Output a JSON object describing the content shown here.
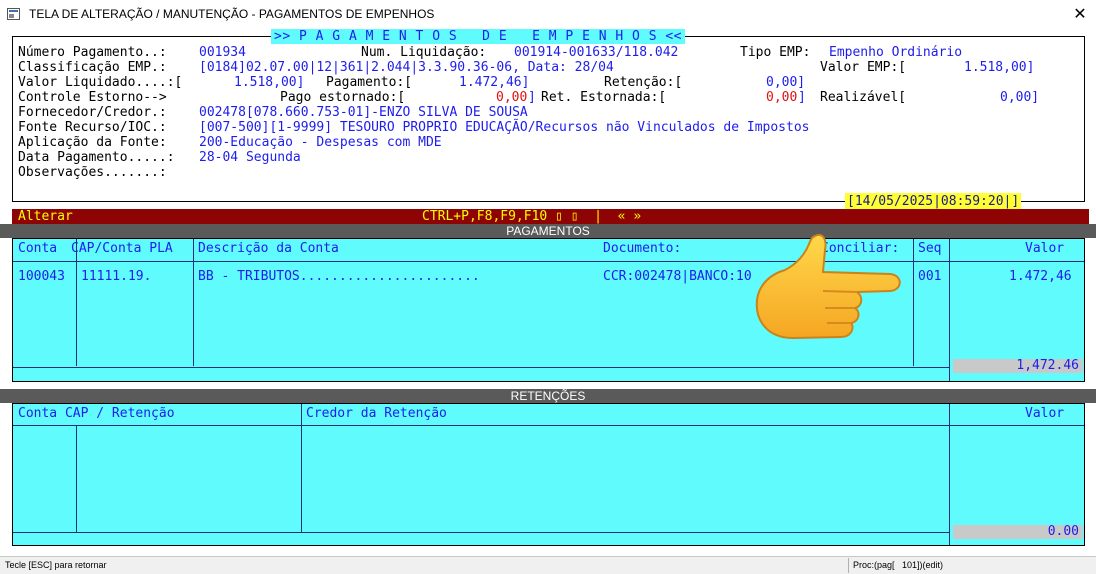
{
  "window": {
    "title": "TELA DE ALTERAÇÃO / MANUTENÇÃO - PAGAMENTOS DE EMPENHOS",
    "close_glyph": "✕"
  },
  "header": {
    "box_title": ">> P A G A M E N T O S   D E   E M P E N H O S <<",
    "numero_pagamento_label": "Número Pagamento..:",
    "numero_pagamento_value": "001934",
    "num_liquidacao_label": "Num. Liquidação:",
    "num_liquidacao_value": "001914-001633/118.042",
    "tipo_emp_label": "Tipo EMP:",
    "tipo_emp_value": "Empenho Ordinário",
    "classificacao_label": "Classificação EMP.:",
    "classificacao_value": "[0184]02.07.00|12|361|2.044|3.3.90.36-06, Data: 28/04",
    "valor_emp_label": "Valor EMP:[",
    "valor_emp_value": "1.518,00]",
    "valor_liquidado_label": "Valor Liquidado....:[",
    "valor_liquidado_value": "1.518,00]",
    "pagamento_label": "Pagamento:[",
    "pagamento_value": "1.472,46]",
    "retencao_label": "Retenção:[",
    "retencao_value": "0,00]",
    "controle_estorno_label": "Controle Estorno-->",
    "pago_estornado_label": "Pago estornado:[",
    "pago_estornado_value": "0,00",
    "ret_estornada_label": "Ret. Estornada:[",
    "ret_estornada_value": "0,00",
    "realizavel_label": "Realizável[",
    "realizavel_value": "0,00]",
    "bracket_close": "]",
    "fornecedor_label": "Fornecedor/Credor.:",
    "fornecedor_value": "002478[078.660.753-01]-ENZO SILVA DE SOUSA",
    "fonte_label": "Fonte Recurso/IOC.:",
    "fonte_value": "[007-500][1-9999] TESOURO PROPRIO EDUCAÇÃO/Recursos não Vinculados de Impostos",
    "aplicacao_label": "Aplicação da Fonte:",
    "aplicacao_value": "200-Educação - Despesas com MDE",
    "data_pagamento_label": "Data Pagamento.....:",
    "data_pagamento_value": "28-04 Segunda",
    "observacoes_label": "Observações.......:",
    "datetime": "[14/05/2025|08:59:20|]"
  },
  "actionbar": {
    "mode": "Alterar",
    "shortcuts": "CTRL+P,F8,F9,F10 ▯ ▯  |  « »"
  },
  "pagamentos": {
    "section_title": "PAGAMENTOS",
    "columns": [
      "Conta",
      "CAP/Conta PLA",
      "Descrição da Conta",
      "Documento:",
      "Conciliar:",
      "Seq",
      "Valor"
    ],
    "rows": [
      {
        "conta": "100043",
        "cap": "11111.19.",
        "descricao": "BB - TRIBUTOS.......................",
        "documento": "CCR:002478|BANCO:10",
        "conciliar": "",
        "seq": "001",
        "valor": "1.472,46"
      }
    ],
    "total": "1,472.46"
  },
  "retencoes": {
    "section_title": "RETENÇÕES",
    "columns": [
      "Conta CAP / Retenção",
      "Credor da Retenção",
      "Valor"
    ],
    "total": "0.00"
  },
  "statusbar": {
    "left": "Tecle [ESC] para retornar",
    "right": "Proc:(pag[   101])(edit)"
  }
}
